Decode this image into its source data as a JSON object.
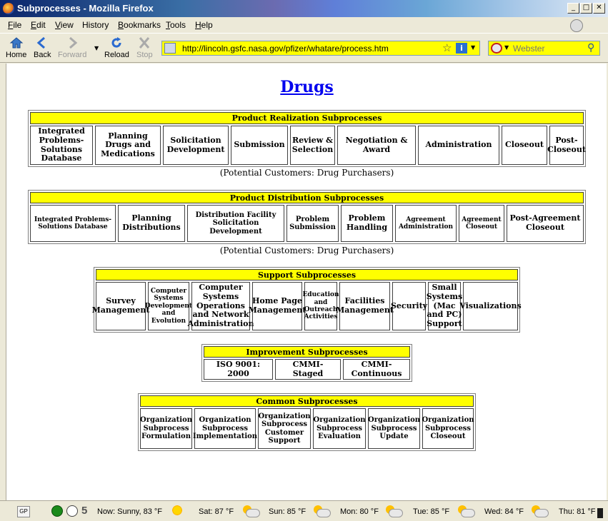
{
  "window": {
    "title": "Subprocesses - Mozilla Firefox"
  },
  "menubar": {
    "items": [
      {
        "label": "File",
        "accel": "F",
        "rest": "ile"
      },
      {
        "label": "Edit",
        "accel": "E",
        "rest": "dit"
      },
      {
        "label": "View",
        "accel": "V",
        "rest": "iew"
      },
      {
        "label": "History",
        "accel": "",
        "rest": "History"
      },
      {
        "label": "Bookmarks",
        "accel": "B",
        "rest": "ookmarks"
      },
      {
        "label": "Tools",
        "accel": "T",
        "rest": "ools"
      },
      {
        "label": "Help",
        "accel": "H",
        "rest": "elp"
      }
    ]
  },
  "navbar": {
    "home": "Home",
    "back": "Back",
    "forward": "Forward",
    "reload": "Reload",
    "stop": "Stop",
    "url": "http://lincoln.gsfc.nasa.gov/pfizer/whatare/process.htm",
    "search_placeholder": "Webster"
  },
  "page": {
    "title": "Drugs",
    "sections": [
      {
        "header": "Product Realization Subprocesses",
        "cells": [
          "Integrated Problems-Solutions Database",
          "Planning Drugs and Medications",
          "Solicitation Development",
          "Submission",
          "Review & Selection",
          "Negotiation & Award",
          "Administration",
          "Closeout",
          "Post-Closeout"
        ],
        "note": "(Potential Customers: Drug Purchasers)"
      },
      {
        "header": "Product Distribution Subprocesses",
        "cells": [
          "Integrated Problems-Solutions Database",
          "Planning Distributions",
          "Distribution Facility Solicitation Development",
          "Problem Submission",
          "Problem Handling",
          "Agreement Administration",
          "Agreement Closeout",
          "Post-Agreement Closeout"
        ],
        "note": "(Potential Customers: Drug Purchasers)"
      },
      {
        "header": "Support Subprocesses",
        "cells": [
          "Survey Management",
          "Computer Systems Development and Evolution",
          "Computer Systems Operations and Network Administration",
          "Home Page Management",
          "Education and Outreach Activities",
          "Facilities Management",
          "Security",
          "Small Systems (Mac and PC) Support",
          "Visualizations"
        ]
      },
      {
        "header": "Improvement Subprocesses",
        "cells": [
          "ISO 9001: 2000",
          "CMMI- Staged",
          "CMMI- Continuous"
        ]
      },
      {
        "header": "Common Subprocesses",
        "cells": [
          "Organization Subprocess Formulation",
          "Organization Subprocess Implementation",
          "Organization Subprocess Customer Support",
          "Organization Subprocess Evaluation",
          "Organization Subprocess Update",
          "Organization Subprocess Closeout"
        ]
      }
    ]
  },
  "statusbar": {
    "gp_badge": "GP",
    "count_badge": "5",
    "weather": [
      {
        "label": "Now: Sunny, 83 °F",
        "icon": "sun-icon"
      },
      {
        "label": "Sat: 87 °F",
        "icon": "partly-cloudy-icon"
      },
      {
        "label": "Sun: 85 °F",
        "icon": "partly-cloudy-icon"
      },
      {
        "label": "Mon: 80 °F",
        "icon": "partly-cloudy-icon"
      },
      {
        "label": "Tue: 85 °F",
        "icon": "partly-cloudy-icon"
      },
      {
        "label": "Wed: 84 °F",
        "icon": "partly-cloudy-icon"
      },
      {
        "label": "Thu: 81 °F",
        "icon": "partly-cloudy-icon"
      }
    ]
  },
  "colors": {
    "header_bg": "#ffff00",
    "link": "#0000ee",
    "urlbar_bg": "#ffff00"
  }
}
